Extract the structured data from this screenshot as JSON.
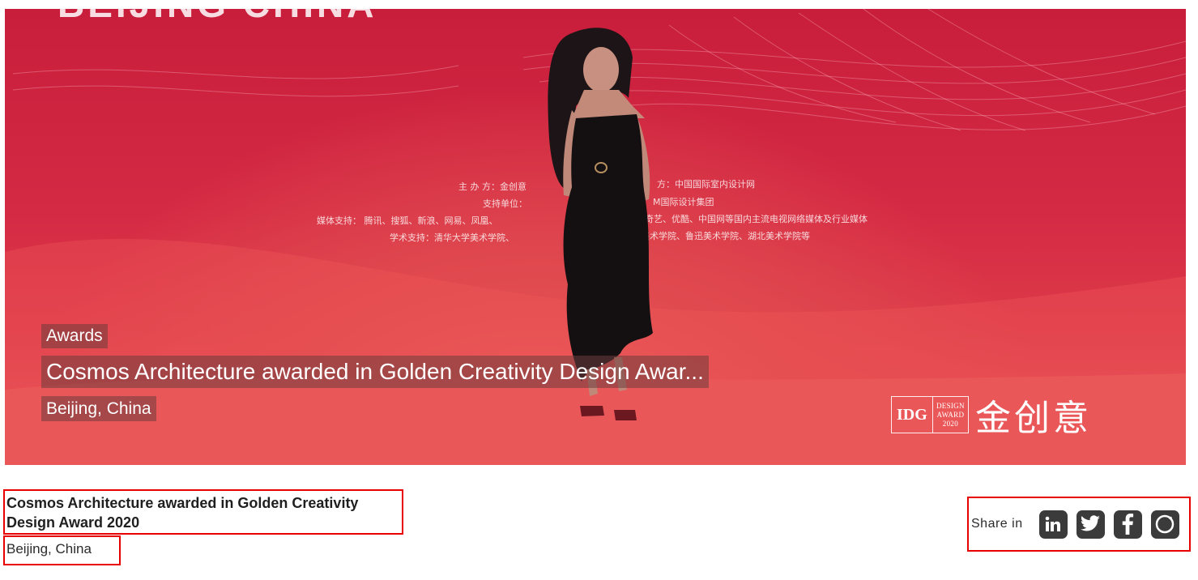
{
  "hero": {
    "category": "Awards",
    "title": "Cosmos Architecture awarded in Golden Creativity Design Awar...",
    "location": "Beijing, China",
    "brand": {
      "mark_text": "IDG",
      "mark_sub_1": "DESIGN",
      "mark_sub_2": "AWARD",
      "mark_sub_3": "2020",
      "chinese": "金创意"
    }
  },
  "article": {
    "title": "Cosmos Architecture awarded in Golden Creativity Design Award 2020",
    "location": "Beijing, China"
  },
  "share": {
    "label": "Share in",
    "icons": [
      "linkedin-icon",
      "twitter-icon",
      "facebook-icon",
      "instagram-icon"
    ]
  },
  "colors": {
    "hero_red": "#d52a44",
    "highlight_border": "#e80000",
    "icon_bg": "#3b3b3b"
  }
}
